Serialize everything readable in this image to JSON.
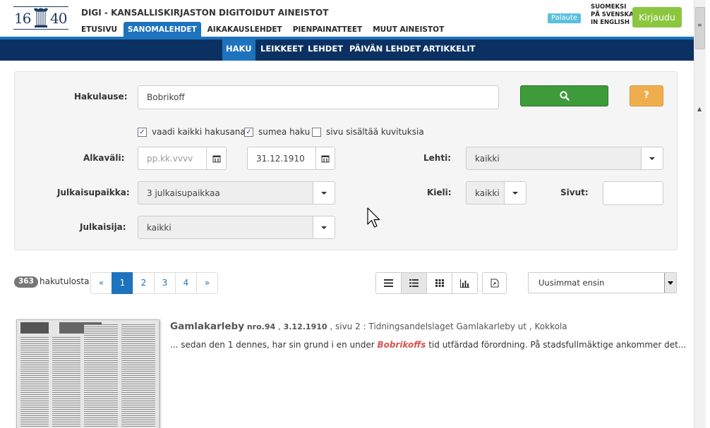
{
  "header": {
    "logo_left": "16",
    "logo_right": "40",
    "site_title": "DIGI - KANSALLISKIRJASTON DIGITOIDUT AINEISTOT",
    "nav": [
      "ETUSIVU",
      "SANOMALEHDET",
      "AIKAKAUSLEHDET",
      "PIENPAINATTEET",
      "MUUT AINEISTOT"
    ],
    "feedback_label": "Palaute",
    "languages": [
      "SUOMEKSI",
      "PÅ SVENSKA",
      "IN ENGLISH"
    ],
    "login_label": "Kirjaudu"
  },
  "subnav": [
    "HAKU",
    "LEIKKEET",
    "LEHDET",
    "PÄIVÄN LEHDET",
    "ARTIKKELIT"
  ],
  "search": {
    "query_label": "Hakulause:",
    "query_value": "Bobrikoff",
    "help_label": "?",
    "checkboxes": [
      {
        "label": "vaadi kaikki hakusanat",
        "checked": true
      },
      {
        "label": "sumea haku",
        "checked": true
      },
      {
        "label": "sivu sisältää kuvituksia",
        "checked": false
      }
    ],
    "date_label": "Alkaväli:",
    "date_from_placeholder": "pp.kk.vvvv",
    "date_to_value": "31.12.1910",
    "paper_label": "Lehti:",
    "paper_value": "kaikki",
    "place_label": "Julkaisupaikka:",
    "place_value": "3 julkaisupaikkaa",
    "language_label": "Kieli:",
    "language_value": "kaikki",
    "pages_label": "Sivut:",
    "pages_value": "",
    "publisher_label": "Julkaisija:",
    "publisher_value": "kaikki"
  },
  "results": {
    "count": "363",
    "count_label": "hakutulosta",
    "pages": [
      "«",
      "1",
      "2",
      "3",
      "4",
      "»"
    ],
    "current_page": "1",
    "sort_value": "Uusimmat ensin",
    "items": [
      {
        "title": "Gamlakarleby",
        "issue": "nro.94",
        "date": "3.12.1910",
        "rest": ", sivu 2 : Tidningsandelslaget Gamlakarleby ut , Kokkola",
        "snippet_before": "... sedan den 1 dennes, har sin grund i en under ",
        "snippet_highlight": "Bobrikoffs",
        "snippet_after": " tid utfärdad förordning. På stadsfullmäktige ankommer det..."
      }
    ]
  },
  "colors": {
    "primary_blue": "#1e73be",
    "dark_navy": "#0b3162",
    "search_green": "#3e9b3a",
    "help_orange": "#f0ad4e",
    "login_green": "#8cc63f",
    "feedback_cyan": "#5bc0de",
    "highlight_red": "#d9534f"
  }
}
